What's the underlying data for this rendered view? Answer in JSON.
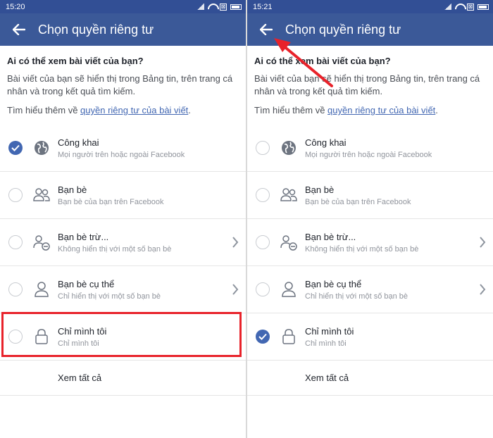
{
  "left": {
    "status_time": "15:20",
    "status_extra": "⊠",
    "title": "Chọn quyền riêng tư",
    "question": "Ai có thể xem bài viết của bạn?",
    "description": "Bài viết của bạn sẽ hiển thị trong Bảng tin, trên trang cá nhân và trong kết quả tìm kiếm.",
    "learn_prefix": "Tìm hiểu thêm về ",
    "learn_link": "quyền riêng tư của bài viết",
    "learn_suffix": ".",
    "options": [
      {
        "title": "Công khai",
        "subtitle": "Mọi người trên hoặc ngoài Facebook",
        "icon": "globe-icon",
        "checked": true
      },
      {
        "title": "Bạn bè",
        "subtitle": "Bạn bè của bạn trên Facebook",
        "icon": "friends-icon",
        "checked": false
      },
      {
        "title": "Bạn bè trừ...",
        "subtitle": "Không hiển thị với một số bạn bè",
        "icon": "friends-except-icon",
        "checked": false
      },
      {
        "title": "Bạn bè cụ thể",
        "subtitle": "Chỉ hiển thị với một số bạn bè",
        "icon": "person-icon",
        "checked": false
      },
      {
        "title": "Chỉ mình tôi",
        "subtitle": "Chỉ mình tôi",
        "icon": "lock-icon",
        "checked": false
      }
    ],
    "see_all": "Xem tất cả"
  },
  "right": {
    "status_time": "15:21",
    "status_extra": "⊠",
    "title": "Chọn quyền riêng tư",
    "question": "Ai có thể xem bài viết của bạn?",
    "description": "Bài viết của bạn sẽ hiển thị trong Bảng tin, trên trang cá nhân và trong kết quả tìm kiếm.",
    "learn_prefix": "Tìm hiểu thêm về ",
    "learn_link": "quyền riêng tư của bài viết",
    "learn_suffix": ".",
    "options": [
      {
        "title": "Công khai",
        "subtitle": "Mọi người trên hoặc ngoài Facebook",
        "icon": "globe-icon",
        "checked": false
      },
      {
        "title": "Bạn bè",
        "subtitle": "Bạn bè của bạn trên Facebook",
        "icon": "friends-icon",
        "checked": false
      },
      {
        "title": "Bạn bè trừ...",
        "subtitle": "Không hiển thị với một số bạn bè",
        "icon": "friends-except-icon",
        "checked": false
      },
      {
        "title": "Bạn bè cụ thể",
        "subtitle": "Chỉ hiển thị với một số bạn bè",
        "icon": "person-icon",
        "checked": false
      },
      {
        "title": "Chỉ mình tôi",
        "subtitle": "Chỉ mình tôi",
        "icon": "lock-icon",
        "checked": true
      }
    ],
    "see_all": "Xem tất cả"
  },
  "colors": {
    "statusbar": "#324f95",
    "appbar": "#3b5998",
    "accent": "#4267b2",
    "annotation": "#e8222a"
  }
}
